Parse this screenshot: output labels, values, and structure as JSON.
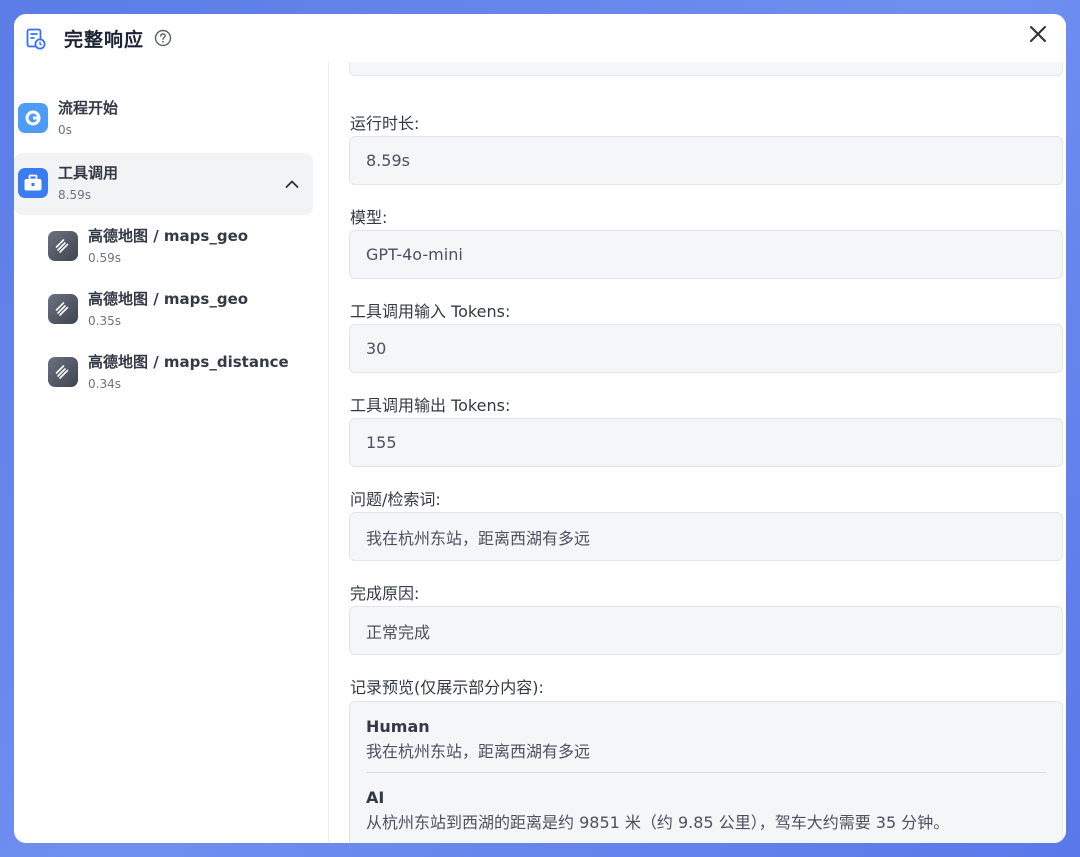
{
  "header": {
    "title": "完整响应"
  },
  "sidebar": {
    "nodes": [
      {
        "label": "流程开始",
        "time": "0s"
      },
      {
        "label": "工具调用",
        "time": "8.59s"
      },
      {
        "label": "高德地图 / maps_geo",
        "time": "0.59s"
      },
      {
        "label": "高德地图 / maps_geo",
        "time": "0.35s"
      },
      {
        "label": "高德地图 / maps_distance",
        "time": "0.34s"
      }
    ]
  },
  "details": {
    "runtime_label": "运行时长:",
    "runtime_value": "8.59s",
    "model_label": "模型:",
    "model_value": "GPT-4o-mini",
    "input_tokens_label": "工具调用输入 Tokens:",
    "input_tokens_value": "30",
    "output_tokens_label": "工具调用输出 Tokens:",
    "output_tokens_value": "155",
    "query_label": "问题/检索词:",
    "query_value": "我在杭州东站，距离西湖有多远",
    "finish_label": "完成原因:",
    "finish_value": "正常完成",
    "preview_label": "记录预览(仅展示部分内容):",
    "preview": [
      {
        "role": "Human",
        "text": "我在杭州东站，距离西湖有多远"
      },
      {
        "role": "AI",
        "text": "从杭州东站到西湖的距离是约 9851 米（约 9.85 公里），驾车大约需要 35 分钟。"
      }
    ]
  },
  "icons": {
    "header": "history-doc-icon",
    "help": "question-circle-icon",
    "close": "close-icon",
    "start": "flow-start-icon",
    "tool": "toolbox-icon",
    "map": "map-tool-icon",
    "expand": "chevron-up-icon"
  },
  "colors": {
    "accent": "#3370ff",
    "background": "#6f8ff0"
  }
}
